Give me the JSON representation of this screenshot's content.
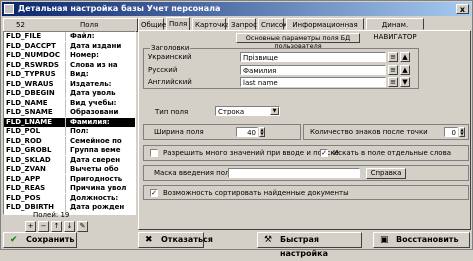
{
  "window": {
    "title": "Детальная настройка базы Учет персонала",
    "close_label": "x"
  },
  "left": {
    "header_count": "52",
    "header_col": "Поля",
    "fields": [
      {
        "name": "FLD_FILE",
        "label": "Файл:"
      },
      {
        "name": "FLD_DACCPT",
        "label": "Дата издани"
      },
      {
        "name": "FLD_NUMDOC",
        "label": "Номер:"
      },
      {
        "name": "FLD_RSWRDS",
        "label": "Слова из на"
      },
      {
        "name": "FLD_TYPRUS",
        "label": "Вид:"
      },
      {
        "name": "FLD_WRAUS",
        "label": "Издатель:"
      },
      {
        "name": "FLD_DBEGIN",
        "label": "Дата уволь"
      },
      {
        "name": "FLD_NAME",
        "label": "Вид учебы:"
      },
      {
        "name": "FLD_SNAME",
        "label": "Образовани"
      },
      {
        "name": "FLD_LNAME",
        "label": "Фамилия:"
      },
      {
        "name": "FLD_POL",
        "label": "Пол:"
      },
      {
        "name": "FLD_ROD",
        "label": "Семейное по"
      },
      {
        "name": "FLD_GROBL",
        "label": "Группа веме"
      },
      {
        "name": "FLD_SKLAD",
        "label": "Дата сверен"
      },
      {
        "name": "FLD_ZVAN",
        "label": "Вычеты обо"
      },
      {
        "name": "FLD_APP",
        "label": "Пригодность"
      },
      {
        "name": "FLD_REAS",
        "label": "Причина увол"
      },
      {
        "name": "FLD_POS",
        "label": "Должность:"
      },
      {
        "name": "FLD_DBIRTH",
        "label": "Дата рожден"
      }
    ],
    "selected_index": 9,
    "field_count": "Полей: 19",
    "tool_icons": [
      "add-icon",
      "delete-icon",
      "up-icon",
      "down-icon",
      "edit-icon"
    ]
  },
  "tabs": [
    "Общие",
    "Поля",
    "Карточка",
    "Запрос",
    "Список",
    "Информационная карточка",
    "Динам. НАВИГАТОР"
  ],
  "active_tab": 1,
  "panel": {
    "basic_params_button": "Основные параметры поля БД пользователя",
    "names_group": "Заголовки",
    "rows": [
      {
        "label": "Украинский",
        "value": "Прізвище"
      },
      {
        "label": "Русский",
        "value": "Фамилия"
      },
      {
        "label": "Английский",
        "value": "last name"
      }
    ],
    "field_type_label": "Тип поля",
    "field_type_value": "Строка",
    "width_label": "Ширина поля",
    "width_value": "40",
    "decimals_label": "Количество знаков после точки",
    "decimals_value": "0",
    "allow_multi_label": "Разрешить много значений при вводе и поиске",
    "allow_multi_checked": false,
    "search_words_label": "Искать в поле отдельные слова",
    "search_words_checked": true,
    "mask_label": "Маска введения поля",
    "mask_value": "",
    "help_button": "Справка",
    "sort_label": "Возможность сортировать найденные документы",
    "sort_checked": true
  },
  "bottom": {
    "save": "Сохранить",
    "cancel": "Отказаться",
    "quick": "Быстрая настройка",
    "restore": "Восстановить"
  },
  "colors": {
    "title_start": "#0a246a",
    "title_end": "#a6caf0",
    "face": "#d4d0c8"
  }
}
